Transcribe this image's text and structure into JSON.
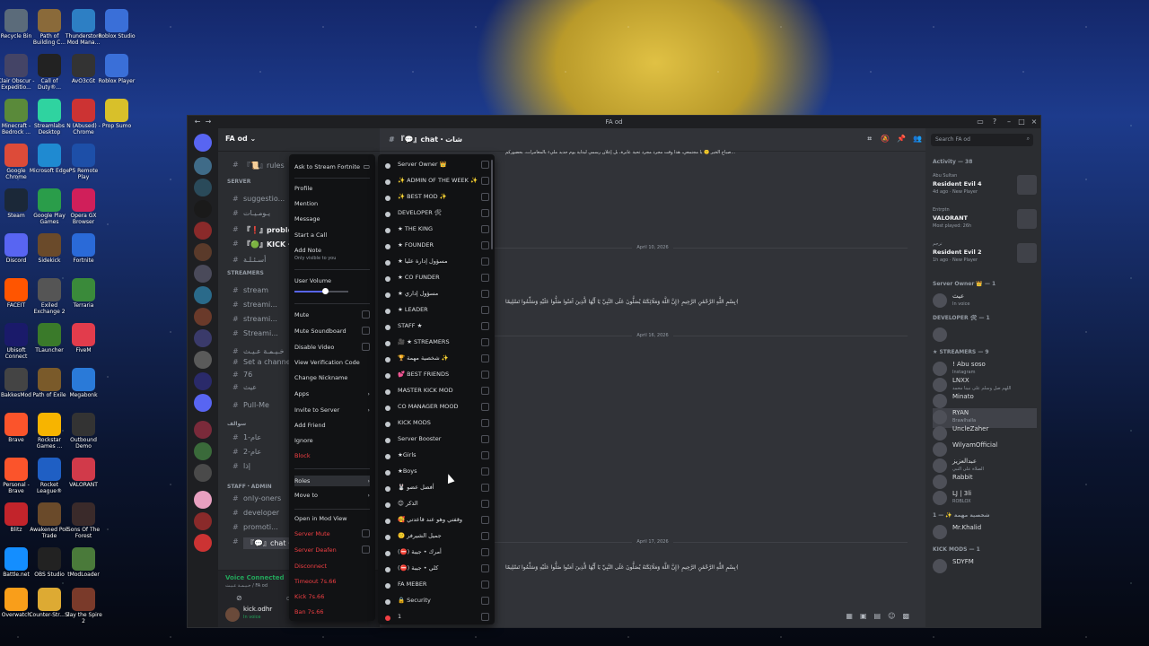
{
  "desktop": {
    "icons": [
      {
        "label": "Recycle Bin",
        "color": "#5b6b7a"
      },
      {
        "label": "Path of Building C...",
        "color": "#8a6a3a"
      },
      {
        "label": "Thunderstore Mod Mana...",
        "color": "#2d7fc4"
      },
      {
        "label": "Roblox Studio",
        "color": "#3a6fd8"
      },
      {
        "label": "Clair Obscur - Expeditio...",
        "color": "#446"
      },
      {
        "label": "Call of Duty®...",
        "color": "#222"
      },
      {
        "label": "AvO3cGt",
        "color": "#333"
      },
      {
        "label": "Roblox Player",
        "color": "#3a6fd8"
      },
      {
        "label": "Minecraft - Bedrock ...",
        "color": "#5a8a3a"
      },
      {
        "label": "Streamlabs Desktop",
        "color": "#2fd3a0"
      },
      {
        "label": "N (Abused) - Chrome",
        "color": "#c33"
      },
      {
        "label": "Prop Sumo",
        "color": "#d8c02a"
      },
      {
        "label": "Google Chrome",
        "color": "#dd4b39"
      },
      {
        "label": "Microsoft Edge",
        "color": "#1f8ad1"
      },
      {
        "label": "PS Remote Play",
        "color": "#1d4fa8"
      },
      {
        "label": "Steam",
        "color": "#1b2838"
      },
      {
        "label": "Google Play Games",
        "color": "#2a9d4a"
      },
      {
        "label": "Opera GX Browser",
        "color": "#d01f5a"
      },
      {
        "label": "Discord",
        "color": "#5865f2"
      },
      {
        "label": "Sidekick",
        "color": "#6a4a2a"
      },
      {
        "label": "Fortnite",
        "color": "#2a6ad8"
      },
      {
        "label": "FACEIT",
        "color": "#ff5500"
      },
      {
        "label": "Exiled Exchange 2",
        "color": "#555"
      },
      {
        "label": "Terraria",
        "color": "#3a8a3a"
      },
      {
        "label": "Ubisoft Connect",
        "color": "#1a1a6a"
      },
      {
        "label": "TLauncher",
        "color": "#3a7a2a"
      },
      {
        "label": "FiveM",
        "color": "#e23c4c"
      },
      {
        "label": "BakkesMod",
        "color": "#444"
      },
      {
        "label": "Path of Exile",
        "color": "#7a5a2a"
      },
      {
        "label": "Megabonk",
        "color": "#2a7ad8"
      },
      {
        "label": "Brave",
        "color": "#fb542b"
      },
      {
        "label": "Rockstar Games ...",
        "color": "#f7b400"
      },
      {
        "label": "Outbound Demo",
        "color": "#333"
      },
      {
        "label": "Personal - Brave",
        "color": "#fb542b"
      },
      {
        "label": "Rocket League®",
        "color": "#1f5fc4"
      },
      {
        "label": "VALORANT",
        "color": "#d13a4a"
      },
      {
        "label": "Blitz",
        "color": "#c2242b"
      },
      {
        "label": "Awakened PoE Trade",
        "color": "#6a4a2a"
      },
      {
        "label": "Sons Of The Forest",
        "color": "#3a2a2a"
      },
      {
        "label": "Battle.net",
        "color": "#148eff"
      },
      {
        "label": "OBS Studio",
        "color": "#222"
      },
      {
        "label": "tModLoader",
        "color": "#4a7a3a"
      },
      {
        "label": "Overwatch",
        "color": "#f99e1a"
      },
      {
        "label": "Counter-Str... 2",
        "color": "#ddaa33"
      },
      {
        "label": "Slay the Spire 2",
        "color": "#7a3a2a"
      }
    ]
  },
  "window": {
    "title": "FA od",
    "back_icon": "arrow-left-icon",
    "forward_icon": "arrow-right-icon"
  },
  "server": {
    "name": "FA od",
    "chevron": "⌄"
  },
  "channels": {
    "items": [
      {
        "label": "『📜』rules"
      },
      {
        "label": "SERVER"
      },
      {
        "label": "suggestio..."
      },
      {
        "label": "يـومـيـات"
      },
      {
        "label": "『❗』problem"
      },
      {
        "label": "『🟢』KICK・..."
      },
      {
        "label": "أسـئـلـة"
      },
      {
        "label": "STREAMERS"
      },
      {
        "label": "stream"
      },
      {
        "label": "streami..."
      },
      {
        "label": "streami..."
      },
      {
        "label": "Streami..."
      },
      {
        "label": "خـيـمـة عـيـث"
      },
      {
        "label": "Set a channel status"
      },
      {
        "label": "76"
      },
      {
        "label": "عيث"
      },
      {
        "label": "Pull-Me"
      },
      {
        "label": "سوالف"
      },
      {
        "label": "عام-1"
      },
      {
        "label": "عام-2"
      },
      {
        "label": "إذا"
      },
      {
        "label": "STAFF・ADMIN"
      },
      {
        "label": "only-oners"
      },
      {
        "label": "developer"
      },
      {
        "label": "promoti..."
      },
      {
        "label": "『💬』chat・..."
      }
    ],
    "voice_connected": "Voice Connected",
    "voice_channel": "خـيـمـة عـيـث / FA od",
    "user": {
      "name": "kick.odhr",
      "status": "In voice"
    }
  },
  "chat": {
    "channel": "『💬』chat・شات",
    "dates": [
      "April 10, 2026",
      "April 16, 2026",
      "April 17, 2026"
    ],
    "verse": "بِسْمِ اللَّهِ الرَّحْمَٰنِ الرَّحِيمِ ﴿إِنَّ اللَّهَ وَمَلَائِكَتَهُ يُصَلُّونَ عَلَى النَّبِيِّ يَا أَيُّهَا الَّذِينَ آمَنُوا صَلُّوا عَلَيْهِ وَسَلِّمُوا تَسْلِيمًا﴾",
    "top_line": "صباح الخير 🙂 يا مجتمعي، هذا وقت مجرد مجرد تحية عابرة، بل إعلان رسمي لبداية يوم جديد مليء بالمغامرات، بحضوركم..."
  },
  "search": {
    "placeholder": "Search FA od"
  },
  "members": {
    "activity_header": "Activity — 38",
    "activities": [
      {
        "name": "Abu Sultan",
        "game": "Resident Evil 4",
        "status": "4d ago · New Player"
      },
      {
        "name": "Entrptn",
        "game": "VALORANT",
        "status": "Most played: 26h"
      },
      {
        "name": "ترجم",
        "game": "Resident Evil 2",
        "status": "1h ago · New Player"
      }
    ],
    "groups": [
      {
        "header": "Server Owner 👑 — 1",
        "members": [
          {
            "name": "عيث",
            "status": "In voice"
          }
        ]
      },
      {
        "header": "DEVELOPER 🛠 — 1",
        "members": [
          {
            "name": "",
            "status": ""
          }
        ]
      },
      {
        "header": "★ STREAMERS — 9",
        "members": [
          {
            "name": "! Abu soso",
            "status": "Instagram"
          },
          {
            "name": "LNXX",
            "status": "اللهم صل وسلم على نبينا محمد"
          },
          {
            "name": "Minato",
            "status": ""
          },
          {
            "name": "RYAN",
            "status": "Brawlhalla"
          },
          {
            "name": "UncleZaher",
            "status": ""
          },
          {
            "name": "WilyamOfficial",
            "status": ""
          },
          {
            "name": "عبدالعزيز",
            "status": "الصلاة على النبي"
          },
          {
            "name": "Rabbit",
            "status": ""
          },
          {
            "name": "LJ | 3li",
            "status": "ROBLOX"
          }
        ]
      },
      {
        "header": "شخصية مهمة ✨ — 1",
        "members": [
          {
            "name": "Mr.Khalid",
            "status": ""
          }
        ]
      },
      {
        "header": "KICK MODS — 1",
        "members": [
          {
            "name": "SDYFM",
            "status": ""
          }
        ]
      }
    ]
  },
  "context_menu": {
    "ask_to_stream": "Ask to Stream Fortnite",
    "profile": "Profile",
    "mention": "Mention",
    "message": "Message",
    "start_call": "Start a Call",
    "add_note": "Add Note",
    "add_note_hint": "Only visible to you",
    "user_volume": "User Volume",
    "volume_level": 0.52,
    "mute": "Mute",
    "mute_soundboard": "Mute Soundboard",
    "disable_video": "Disable Video",
    "view_verification": "View Verification Code",
    "change_nickname": "Change Nickname",
    "apps": "Apps",
    "invite": "Invite to Server",
    "add_friend": "Add Friend",
    "ignore": "Ignore",
    "block": "Block",
    "roles": "Roles",
    "move_to": "Move to",
    "open_mod_view": "Open in Mod View",
    "server_mute": "Server Mute",
    "server_deafen": "Server Deafen",
    "disconnect": "Disconnect",
    "timeout": "Timeout 7s.66",
    "kick": "Kick 7s.66",
    "ban": "Ban 7s.66"
  },
  "roles_menu": [
    {
      "label": "Server Owner 👑",
      "color": "#c4c9ce"
    },
    {
      "label": "✨ ADMIN OF THE WEEK ✨",
      "color": "#c4c9ce"
    },
    {
      "label": "✨ BEST MOD ✨",
      "color": "#c4c9ce"
    },
    {
      "label": "DEVELOPER 🛠",
      "color": "#c4c9ce"
    },
    {
      "label": "★ THE KING",
      "color": "#c4c9ce"
    },
    {
      "label": "★ FOUNDER",
      "color": "#c4c9ce"
    },
    {
      "label": "★ مسؤول إدارة عليا",
      "color": "#c4c9ce"
    },
    {
      "label": "★ CO FUNDER",
      "color": "#c4c9ce"
    },
    {
      "label": "★ مسؤول إداري",
      "color": "#c4c9ce"
    },
    {
      "label": "★ LEADER",
      "color": "#c4c9ce"
    },
    {
      "label": "STAFF ★",
      "color": "#c4c9ce"
    },
    {
      "label": "🎥 ★ STREAMERS",
      "color": "#c4c9ce"
    },
    {
      "label": "🏆 شخصية مهمة ✨",
      "color": "#c4c9ce"
    },
    {
      "label": "💕 BEST FRIENDS",
      "color": "#c4c9ce"
    },
    {
      "label": "MASTER KICK MOD",
      "color": "#c4c9ce"
    },
    {
      "label": "CO MANAGER MOOD",
      "color": "#c4c9ce"
    },
    {
      "label": "KICK MODS",
      "color": "#c4c9ce"
    },
    {
      "label": "Server Booster",
      "color": "#c4c9ce"
    },
    {
      "label": "★Girls",
      "color": "#c4c9ce"
    },
    {
      "label": "★Boys",
      "color": "#c4c9ce"
    },
    {
      "label": "🐰 أفضل عضو",
      "color": "#c4c9ce"
    },
    {
      "label": "😊 الذكر",
      "color": "#c4c9ce"
    },
    {
      "label": "🥰 وقفتي وهو عند قاعدتي",
      "color": "#c4c9ce"
    },
    {
      "label": "🙂 جميل الشيرفر",
      "color": "#c4c9ce"
    },
    {
      "label": "(⛔) أمرك • جيبة",
      "color": "#c4c9ce"
    },
    {
      "label": "(⛔) كلي • جيبة",
      "color": "#c4c9ce"
    },
    {
      "label": "FA MEBER",
      "color": "#c4c9ce"
    },
    {
      "label": "🔒 Security",
      "color": "#c4c9ce"
    },
    {
      "label": "1",
      "color": "#f23f43"
    }
  ]
}
